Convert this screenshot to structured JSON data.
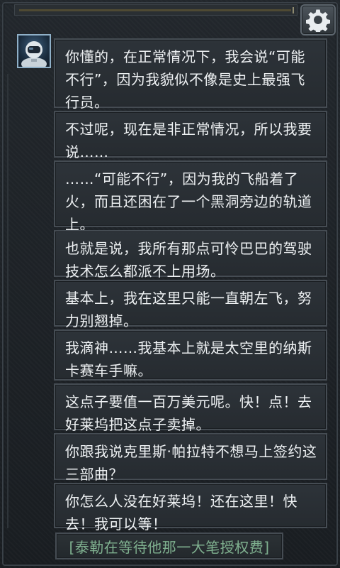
{
  "header": {
    "settings_icon": "gear-icon"
  },
  "speaker": {
    "avatar_icon": "astronaut-helmet-icon"
  },
  "messages": [
    "你懂的，在正常情况下，我会说“可能不行”，因为我貌似不像是史上最强飞行员。",
    "不过呢，现在是非正常情况，所以我要说……",
    "……“可能不行”，因为我的飞船着了火，而且还困在了一个黑洞旁边的轨道上。",
    "也就是说，我所有那点可怜巴巴的驾驶技术怎么都派不上用场。",
    "基本上，我在这里只能一直朝左飞，努力别翘掉。",
    "我滴神……我基本上就是太空里的纳斯卡赛车手嘛。",
    "这点子要值一百万美元呢。快！点！去好莱坞把这点子卖掉。",
    "你跟我说克里斯·帕拉特不想马上签约这三部曲？",
    "你怎么人没在好莱坞！还在这里！快去！我可以等！"
  ],
  "status": {
    "text": "[泰勒在等待他那一大笔授权费]",
    "color": "#7fb08f"
  },
  "colors": {
    "background": "#1c2024",
    "bubble_border": "#454c53",
    "text": "#eef1f3"
  }
}
